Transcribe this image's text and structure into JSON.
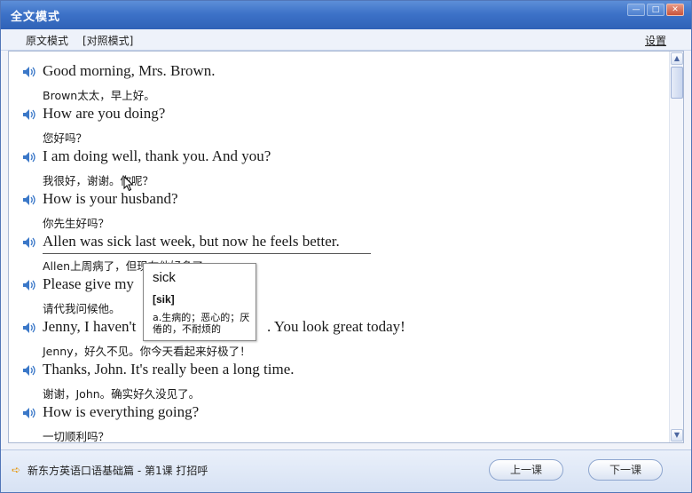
{
  "window": {
    "title": "全文模式"
  },
  "menu": {
    "items": [
      "原文模式",
      "[对照模式]"
    ],
    "settings_label": "设置"
  },
  "window_buttons": [
    "—",
    "□",
    "✕"
  ],
  "lines": [
    {
      "en": "Good morning, Mrs. Brown.",
      "zh": "Brown太太，早上好。"
    },
    {
      "en": "How are you doing?",
      "zh": "您好吗？"
    },
    {
      "en": "I am doing well, thank you. And you?",
      "zh": "我很好，谢谢。你呢？"
    },
    {
      "en": "How is your husband?",
      "zh": "你先生好吗？"
    },
    {
      "en": "Allen was sick last week, but now he feels better.",
      "zh": "Allen上周病了，但现在他好多了。"
    },
    {
      "en": "Please give my",
      "zh": "请代我问候他。"
    },
    {
      "en": "Jenny, I haven't",
      "en_tail": ". You look great today!",
      "zh": "Jenny，好久不见。你今天看起来好极了！"
    },
    {
      "en": "Thanks, John. It's really been a long time.",
      "zh": "谢谢，John。确实好久没见了。"
    },
    {
      "en": "How is everything going?",
      "zh": "一切顺利吗？"
    }
  ],
  "popup": {
    "word": "sick",
    "phonetic": "[sik]",
    "definition": "a.生病的；恶心的；厌倦的，不耐烦的"
  },
  "status": {
    "text": "新东方英语口语基础篇 - 第1课 打招呼"
  },
  "nav": {
    "prev_label": "上一课",
    "next_label": "下一课"
  },
  "icons": {
    "speaker": "speaker-icon",
    "status_arrow": "arrow-right-icon",
    "cursor": "mouse-cursor-icon"
  }
}
